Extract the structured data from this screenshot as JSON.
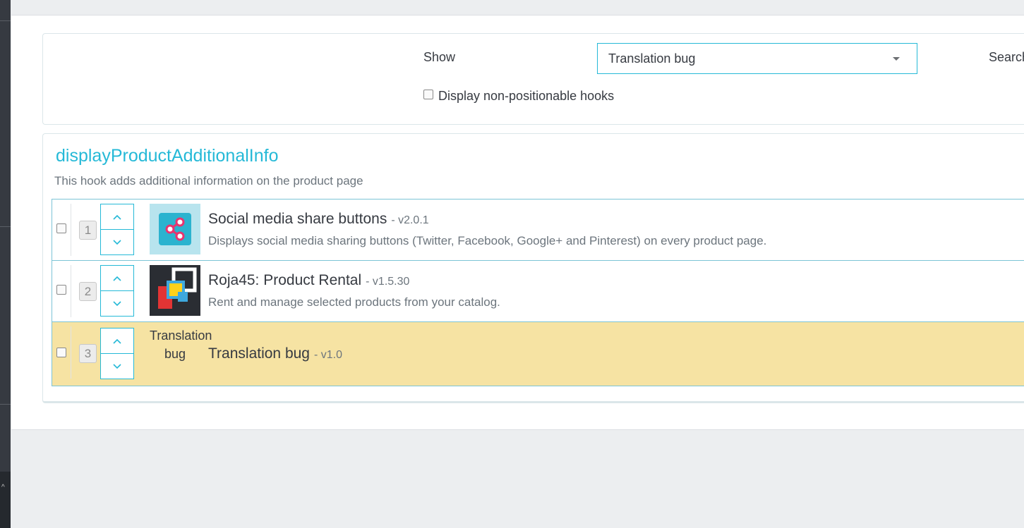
{
  "filters": {
    "show_label": "Show",
    "selected_module": "Translation bug",
    "search_label": "Search",
    "non_positionable_label": "Display non-positionable hooks",
    "non_positionable_checked": false
  },
  "hook": {
    "name": "displayProductAdditionalInfo",
    "description": "This hook adds additional information on the product page",
    "modules": [
      {
        "position": "1",
        "name": "Social media share buttons",
        "version": "- v2.0.1",
        "description": "Displays social media sharing buttons (Twitter, Facebook, Google+ and Pinterest) on every product page.",
        "logo": "share-icon"
      },
      {
        "position": "2",
        "name": "Roja45: Product Rental",
        "version": "- v1.5.30",
        "description": "Rent and manage selected products from your catalog.",
        "logo": "roja45-logo"
      },
      {
        "position": "3",
        "name": "Translation bug",
        "version": "- v1.0",
        "description": "",
        "logo_alt": "Translation bug",
        "highlighted": true
      }
    ]
  },
  "colors": {
    "accent": "#25b9d7",
    "highlight_row": "#f6e3a3",
    "sidebar": "#363a41"
  }
}
